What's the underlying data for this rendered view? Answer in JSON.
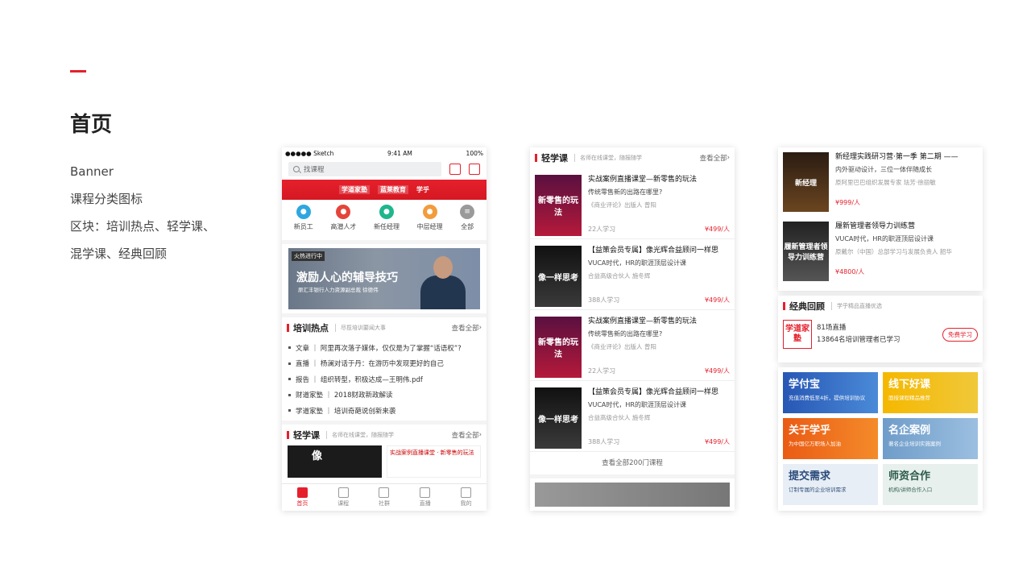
{
  "page": {
    "title": "首页",
    "desc_lines": [
      "Banner",
      "课程分类图标",
      "区块：培训热点、轻学课、",
      "混学课、经典回顾"
    ]
  },
  "phone1": {
    "status": {
      "carrier": "●●●●● Sketch",
      "time": "9:41 AM",
      "battery": "100%"
    },
    "search_placeholder": "找课程",
    "red_strip": [
      "学道家塾",
      "蓝莱教育",
      "学乎"
    ],
    "categories": [
      "新员工",
      "高潜人才",
      "新任经理",
      "中层经理",
      "全部"
    ],
    "banner": {
      "tag": "火热进行中",
      "title": "激励人心的辅导技巧",
      "subtitle": "原汇丰银行人力资源副总裁 徐德伟"
    },
    "hot": {
      "title": "培训热点",
      "subtitle": "尽揽培训要闻大事",
      "more": "查看全部",
      "items": [
        "文章 ｜ 阿里再次落子媒体，仅仅是为了掌握“话语权”?",
        "直播 ｜ 杨澜对话于丹：在游历中发现更好的自己",
        "报告 ｜ 组织转型，积极达成—王明伟.pdf",
        "财道家塾 ｜ 2018财政新政解读",
        "学道家塾 ｜ 培训奇葩说创新来袭"
      ]
    },
    "light": {
      "title": "轻学课",
      "subtitle": "名师在线课堂，随报随学",
      "more": "查看全部",
      "thumb1": "像",
      "thumb2": "实战案例直播课堂 · 新零售的玩法"
    },
    "tabs": [
      "首页",
      "课程",
      "社群",
      "直播",
      "我的"
    ]
  },
  "phone2": {
    "header": {
      "title": "轻学课",
      "subtitle": "名师在线课堂，随报随学",
      "more": "查看全部"
    },
    "courses": [
      {
        "thumb": "新零售的玩法",
        "title": "实战案例直播课堂—新零售的玩法",
        "subtitle": "传统零售新的出路在哪里?",
        "author": "《商业评论》出版人 曾阳",
        "count": "22人学习",
        "price": "¥499/人"
      },
      {
        "thumb": "像一样思考",
        "title": "【益策会员专属】像光辉合益顾问一样思",
        "subtitle": "VUCA时代，HR的职涯顶层设计课",
        "author": "合益高级合伙人 施冬辉",
        "count": "388人学习",
        "price": "¥499/人"
      },
      {
        "thumb": "新零售的玩法",
        "title": "实战案例直播课堂—新零售的玩法",
        "subtitle": "传统零售新的出路在哪里?",
        "author": "《商业评论》出版人 曾阳",
        "count": "22人学习",
        "price": "¥499/人"
      },
      {
        "thumb": "像一样思考",
        "title": "【益策会员专属】像光辉合益顾问一样思",
        "subtitle": "VUCA时代，HR的职涯顶层设计课",
        "author": "合益高级合伙人 施冬辉",
        "count": "388人学习",
        "price": "¥499/人"
      }
    ],
    "view_all": "查看全部200门课程"
  },
  "phone3": {
    "courses": [
      {
        "thumb": "新经理",
        "title": "新经理实践研习营·第一季 第二期 ——",
        "subtitle": "内外驱动设计，三位一体伴随成长",
        "author": "原阿里巴巴组织发展专家 珐芳·徐丽敏",
        "price": "¥999/人"
      },
      {
        "thumb": "履新管理者领导力训练营",
        "title": "履新管理者领导力训练营",
        "subtitle": "VUCA时代，HR的职涯顶层设计课",
        "author": "原戴尔（中国）总部学习与发展负责人 韶华",
        "price": "¥4800/人"
      }
    ],
    "classic": {
      "title": "经典回顾",
      "subtitle": "学乎精品直播优选",
      "logo": "学道家塾",
      "line1": "81场直播",
      "line2": "13864名培训管理者已学习",
      "button": "免费学习"
    },
    "tiles": [
      {
        "title": "学付宝",
        "subtitle": "充值消费低至4折，提供培训协议"
      },
      {
        "title": "线下好课",
        "subtitle": "面授课程精品推荐"
      },
      {
        "title": "关于学乎",
        "subtitle": "为中国亿万职场人加油"
      },
      {
        "title": "名企案例",
        "subtitle": "著名企业培训实施案例"
      },
      {
        "title": "提交需求",
        "subtitle": "订制专属的企业培训需求"
      },
      {
        "title": "师资合作",
        "subtitle": "机构/讲师合作入口"
      }
    ]
  }
}
